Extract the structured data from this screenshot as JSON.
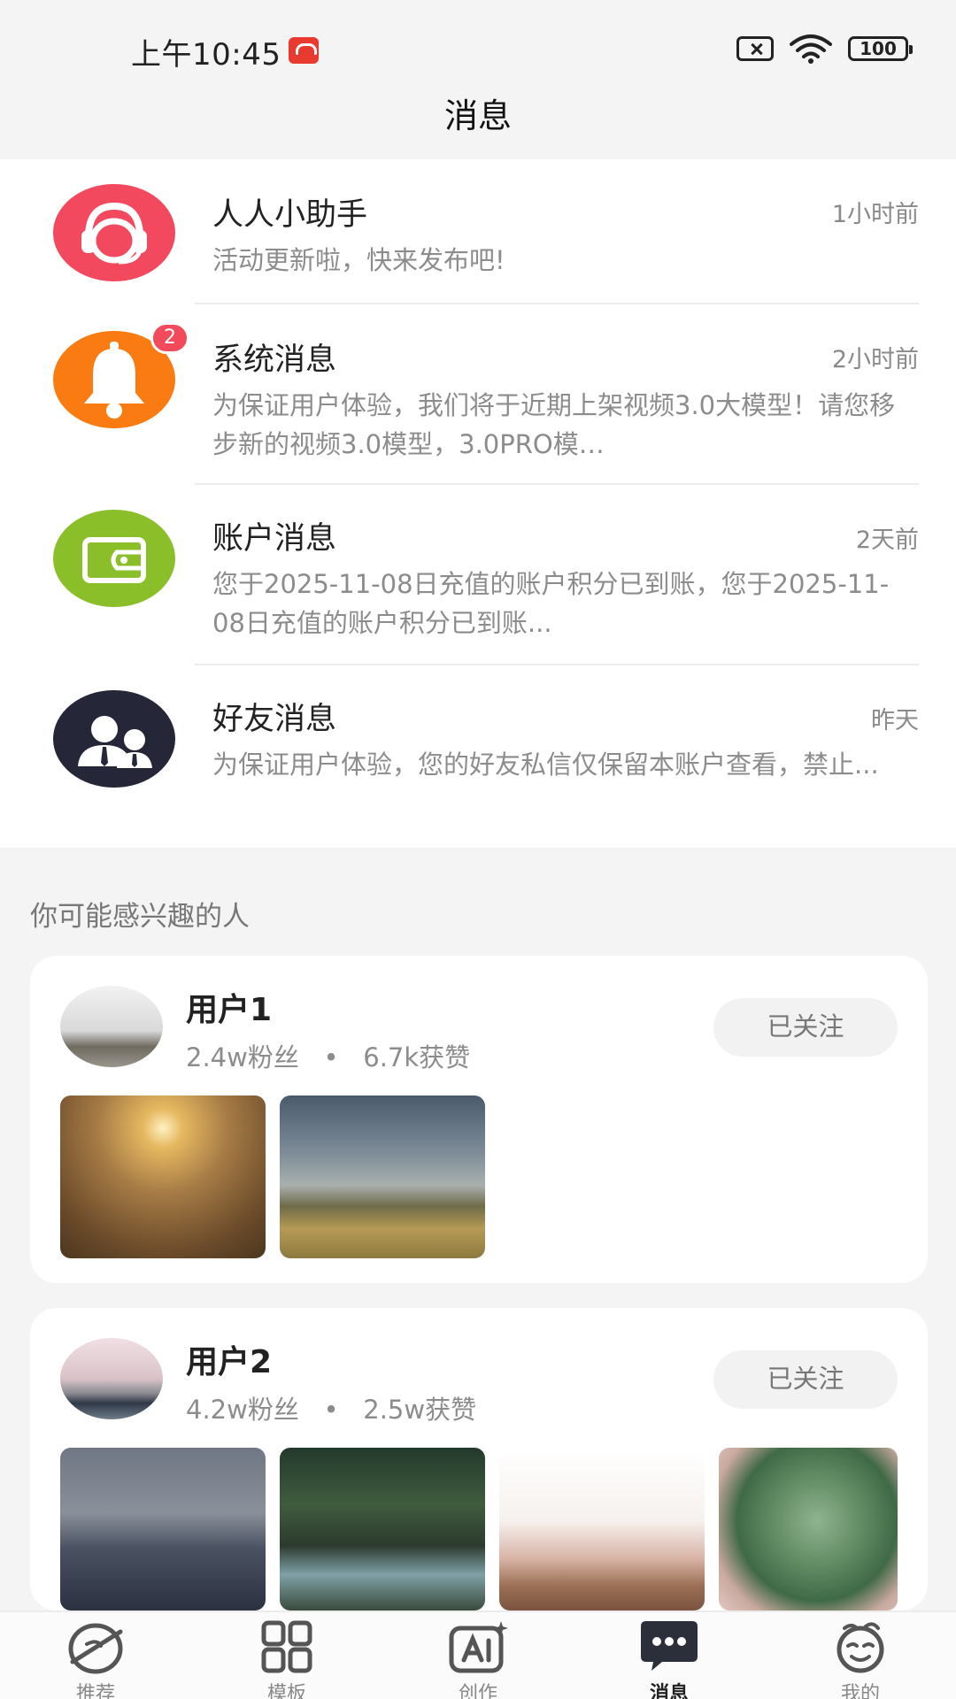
{
  "status_bar": {
    "time": "上午10:45",
    "battery": "100",
    "icons": [
      "app-notification-icon",
      "no-sim-icon",
      "wifi-icon",
      "battery-icon"
    ]
  },
  "header": {
    "title": "消息"
  },
  "messages": [
    {
      "title": "人人小助手",
      "time": "1小时前",
      "preview": "活动更新啦，快来发布吧!",
      "icon": "headset-icon",
      "color": "#f2495e"
    },
    {
      "title": "系统消息",
      "time": "2小时前",
      "preview": "为保证用户体验，我们将于近期上架视频3.0大模型！请您移步新的视频3.0模型，3.0PRO模…",
      "icon": "bell-icon",
      "color": "#fa7b12",
      "badge": "2"
    },
    {
      "title": "账户消息",
      "time": "2天前",
      "preview": "您于2025-11-08日充值的账户积分已到账，您于2025-11-08日充值的账户积分已到账...",
      "icon": "wallet-icon",
      "color": "#8bbf2a"
    },
    {
      "title": "好友消息",
      "time": "昨天",
      "preview": "为保证用户体验，您的好友私信仅保留本账户查看，禁止...",
      "icon": "friends-icon",
      "color": "#252638"
    }
  ],
  "recommend": {
    "title": "你可能感兴趣的人",
    "users": [
      {
        "name": "用户1",
        "fans": "2.4w粉丝",
        "likes": "6.7k获赞",
        "follow_label": "已关注"
      },
      {
        "name": "用户2",
        "fans": "4.2w粉丝",
        "likes": "2.5w获赞",
        "follow_label": "已关注"
      }
    ]
  },
  "nav": {
    "items": [
      {
        "label": "推荐",
        "icon": "planet-icon"
      },
      {
        "label": "模板",
        "icon": "template-grid-icon"
      },
      {
        "label": "创作",
        "icon": "ai-create-icon"
      },
      {
        "label": "消息",
        "icon": "message-icon",
        "active": true
      },
      {
        "label": "我的",
        "icon": "profile-face-icon"
      }
    ]
  },
  "colors": {
    "accent_red": "#f24a5a",
    "page_bg": "#f4f4f4",
    "card_bg": "#ffffff",
    "nav_active": "#222222"
  }
}
